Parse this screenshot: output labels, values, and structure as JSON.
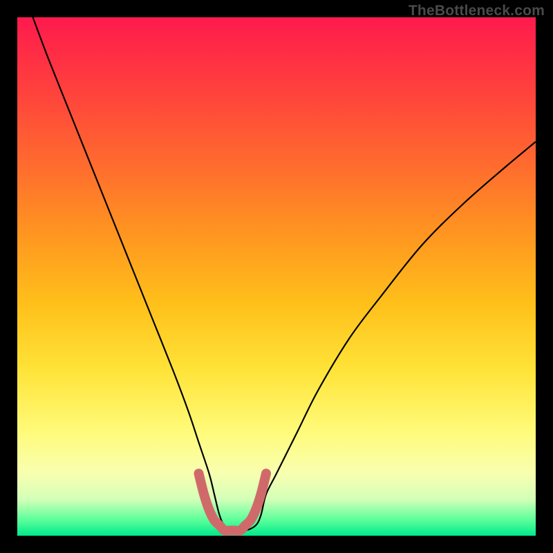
{
  "watermark": "TheBottleneck.com",
  "chart_data": {
    "type": "line",
    "title": "",
    "xlabel": "",
    "ylabel": "",
    "xlim": [
      0,
      100
    ],
    "ylim": [
      0,
      100
    ],
    "annotations": [],
    "background_gradient": {
      "top_color": "#ff1a4d",
      "bottom_color": "#00e88a",
      "description": "red-to-green vertical gradient; red=high bottleneck, green=low"
    },
    "series": [
      {
        "name": "bottleneck-curve",
        "color": "#000000",
        "x": [
          3,
          6,
          10,
          14,
          18,
          22,
          26,
          30,
          33,
          35,
          37,
          38,
          39,
          40,
          42,
          44,
          46,
          47,
          48,
          50,
          54,
          58,
          64,
          70,
          78,
          86,
          94,
          100
        ],
        "y": [
          100,
          92,
          82,
          72,
          62,
          52,
          42,
          32,
          24,
          18,
          12,
          8,
          4,
          2,
          1,
          1,
          2,
          4,
          8,
          12,
          20,
          28,
          38,
          46,
          56,
          64,
          71,
          76
        ]
      },
      {
        "name": "optimal-range-marker",
        "color": "#d06a6a",
        "x": [
          35,
          36,
          37,
          38,
          39,
          40,
          41,
          42,
          43,
          44,
          45,
          46,
          47,
          48
        ],
        "y": [
          12,
          8,
          5,
          3,
          2,
          1,
          1,
          1,
          1,
          2,
          3,
          5,
          8,
          12
        ]
      }
    ]
  }
}
